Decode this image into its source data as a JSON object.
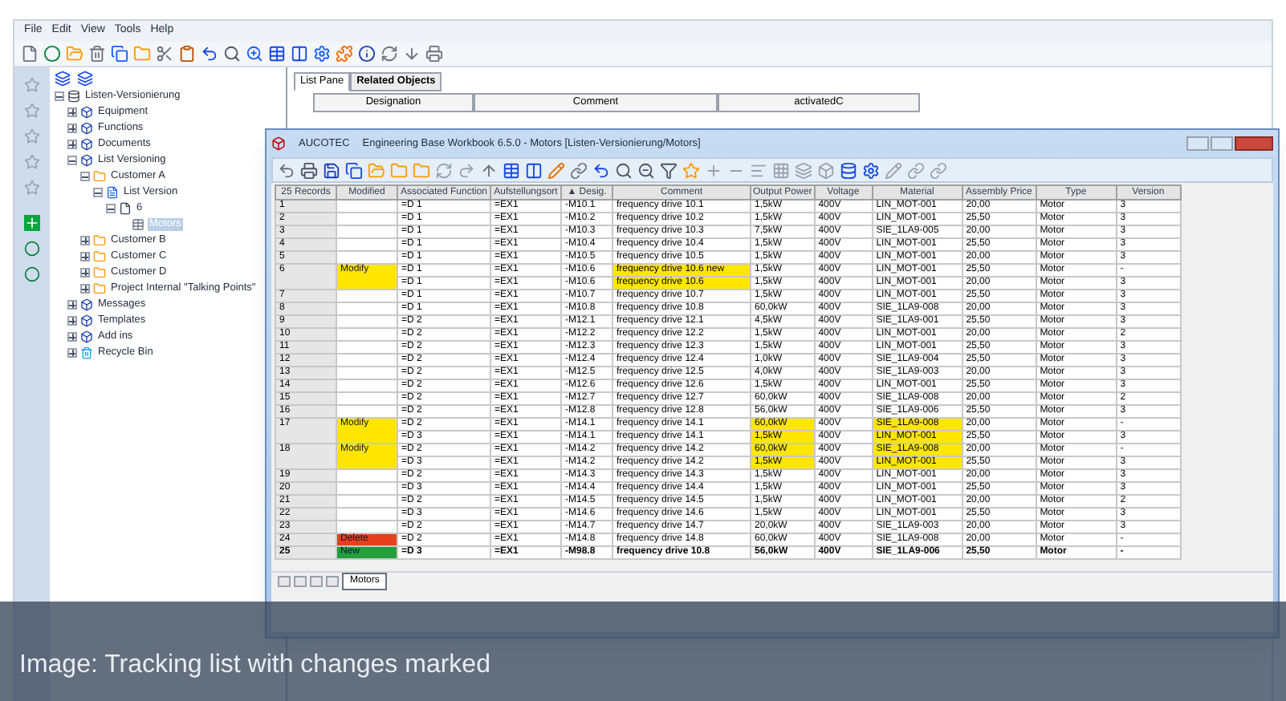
{
  "app": {
    "menu": [
      "File",
      "Edit",
      "View",
      "Tools",
      "Help"
    ],
    "tree": [
      {
        "label": "Listen-Versionierung",
        "kind": "root",
        "expanded": true,
        "children": [
          {
            "label": "Equipment",
            "kind": "module",
            "expanded": false
          },
          {
            "label": "Functions",
            "kind": "module",
            "expanded": false
          },
          {
            "label": "Documents",
            "kind": "module",
            "expanded": false
          },
          {
            "label": "List Versioning",
            "kind": "module",
            "expanded": true,
            "children": [
              {
                "label": "Customer A",
                "kind": "folder",
                "expanded": true,
                "children": [
                  {
                    "label": "List Version",
                    "kind": "version",
                    "expanded": true,
                    "children": [
                      {
                        "label": "6",
                        "kind": "sheet",
                        "expanded": true,
                        "children": [
                          {
                            "label": "Motors",
                            "kind": "item",
                            "selected": true
                          }
                        ]
                      }
                    ]
                  }
                ]
              },
              {
                "label": "Customer B",
                "kind": "folder",
                "expanded": false
              },
              {
                "label": "Customer C",
                "kind": "folder",
                "expanded": false
              },
              {
                "label": "Customer D",
                "kind": "folder",
                "expanded": false
              },
              {
                "label": "Project Internal \"Talking Points\"",
                "kind": "folder",
                "expanded": false
              }
            ]
          },
          {
            "label": "Messages",
            "kind": "module",
            "expanded": false
          },
          {
            "label": "Templates",
            "kind": "module",
            "expanded": false
          },
          {
            "label": "Add ins",
            "kind": "module",
            "expanded": false
          },
          {
            "label": "Recycle Bin",
            "kind": "bin",
            "expanded": false
          }
        ]
      }
    ],
    "pane_tabs": [
      {
        "label": "List Pane",
        "selected": true
      },
      {
        "label": "Related Objects",
        "selected": false
      }
    ],
    "pane_columns": [
      "Designation",
      "Comment",
      "activatedC"
    ]
  },
  "workbook": {
    "brand": "AUCOTEC",
    "title": "Engineering Base Workbook 6.5.0 - Motors [Listen-Versionierung/Motors]",
    "columns": [
      "25 Records",
      "Modified",
      "Associated Function",
      "Aufstellungsort",
      "▲ Desig.",
      "Comment",
      "Output Power",
      "Voltage",
      "Material",
      "Assembly Price",
      "Type",
      "Version"
    ],
    "rows": [
      {
        "number": "1",
        "lines": [
          {
            "func": "=D 1",
            "location": "=EX1",
            "desig": "-M10.1",
            "comment": "frequency drive 10.1",
            "power": "1,5kW",
            "voltage": "400V",
            "material": "LIN_MOT-001",
            "price": "20,00",
            "type": "Motor",
            "version": "3"
          }
        ]
      },
      {
        "number": "2",
        "lines": [
          {
            "func": "=D 1",
            "location": "=EX1",
            "desig": "-M10.2",
            "comment": "frequency drive 10.2",
            "power": "1,5kW",
            "voltage": "400V",
            "material": "LIN_MOT-001",
            "price": "25,50",
            "type": "Motor",
            "version": "3"
          }
        ]
      },
      {
        "number": "3",
        "lines": [
          {
            "func": "=D 1",
            "location": "=EX1",
            "desig": "-M10.3",
            "comment": "frequency drive 10.3",
            "power": "7,5kW",
            "voltage": "400V",
            "material": "SIE_1LA9-005",
            "price": "20,00",
            "type": "Motor",
            "version": "3"
          }
        ]
      },
      {
        "number": "4",
        "lines": [
          {
            "func": "=D 1",
            "location": "=EX1",
            "desig": "-M10.4",
            "comment": "frequency drive 10.4",
            "power": "1,5kW",
            "voltage": "400V",
            "material": "LIN_MOT-001",
            "price": "25,50",
            "type": "Motor",
            "version": "3"
          }
        ]
      },
      {
        "number": "5",
        "lines": [
          {
            "func": "=D 1",
            "location": "=EX1",
            "desig": "-M10.5",
            "comment": "frequency drive 10.5",
            "power": "1,5kW",
            "voltage": "400V",
            "material": "LIN_MOT-001",
            "price": "20,00",
            "type": "Motor",
            "version": "3"
          }
        ]
      },
      {
        "number": "6",
        "status": {
          "text": "Modify",
          "color": "#ffe600"
        },
        "lines": [
          {
            "func": "=D 1",
            "location": "=EX1",
            "desig": "-M10.6",
            "comment": "frequency drive 10.6 new",
            "power": "1,5kW",
            "voltage": "400V",
            "material": "LIN_MOT-001",
            "price": "25,50",
            "type": "Motor",
            "version": "-",
            "comment_changed": true,
            "power_changed": false,
            "material_changed": false
          },
          {
            "func": "=D 1",
            "location": "=EX1",
            "desig": "-M10.6",
            "comment": "frequency drive 10.6",
            "power": "1,5kW",
            "voltage": "400V",
            "material": "LIN_MOT-001",
            "price": "20,00",
            "type": "Motor",
            "version": "3",
            "comment_changed": true,
            "power_changed": false,
            "material_changed": false
          }
        ]
      },
      {
        "number": "7",
        "lines": [
          {
            "func": "=D 1",
            "location": "=EX1",
            "desig": "-M10.7",
            "comment": "frequency drive 10.7",
            "power": "1,5kW",
            "voltage": "400V",
            "material": "LIN_MOT-001",
            "price": "25,50",
            "type": "Motor",
            "version": "3"
          }
        ]
      },
      {
        "number": "8",
        "lines": [
          {
            "func": "=D 1",
            "location": "=EX1",
            "desig": "-M10.8",
            "comment": "frequency drive 10.8",
            "power": "60,0kW",
            "voltage": "400V",
            "material": "SIE_1LA9-008",
            "price": "20,00",
            "type": "Motor",
            "version": "3"
          }
        ]
      },
      {
        "number": "9",
        "lines": [
          {
            "func": "=D 2",
            "location": "=EX1",
            "desig": "-M12.1",
            "comment": "frequency drive 12.1",
            "power": "4,5kW",
            "voltage": "400V",
            "material": "SIE_1LA9-001",
            "price": "25,50",
            "type": "Motor",
            "version": "3"
          }
        ]
      },
      {
        "number": "10",
        "lines": [
          {
            "func": "=D 2",
            "location": "=EX1",
            "desig": "-M12.2",
            "comment": "frequency drive 12.2",
            "power": "1,5kW",
            "voltage": "400V",
            "material": "LIN_MOT-001",
            "price": "20,00",
            "type": "Motor",
            "version": "2"
          }
        ]
      },
      {
        "number": "11",
        "lines": [
          {
            "func": "=D 2",
            "location": "=EX1",
            "desig": "-M12.3",
            "comment": "frequency drive 12.3",
            "power": "1,5kW",
            "voltage": "400V",
            "material": "LIN_MOT-001",
            "price": "25,50",
            "type": "Motor",
            "version": "3"
          }
        ]
      },
      {
        "number": "12",
        "lines": [
          {
            "func": "=D 2",
            "location": "=EX1",
            "desig": "-M12.4",
            "comment": "frequency drive 12.4",
            "power": "1,0kW",
            "voltage": "400V",
            "material": "SIE_1LA9-004",
            "price": "25,50",
            "type": "Motor",
            "version": "3"
          }
        ]
      },
      {
        "number": "13",
        "lines": [
          {
            "func": "=D 2",
            "location": "=EX1",
            "desig": "-M12.5",
            "comment": "frequency drive 12.5",
            "power": "4,0kW",
            "voltage": "400V",
            "material": "SIE_1LA9-003",
            "price": "20,00",
            "type": "Motor",
            "version": "3"
          }
        ]
      },
      {
        "number": "14",
        "lines": [
          {
            "func": "=D 2",
            "location": "=EX1",
            "desig": "-M12.6",
            "comment": "frequency drive 12.6",
            "power": "1,5kW",
            "voltage": "400V",
            "material": "LIN_MOT-001",
            "price": "25,50",
            "type": "Motor",
            "version": "3"
          }
        ]
      },
      {
        "number": "15",
        "lines": [
          {
            "func": "=D 2",
            "location": "=EX1",
            "desig": "-M12.7",
            "comment": "frequency drive 12.7",
            "power": "60,0kW",
            "voltage": "400V",
            "material": "SIE_1LA9-008",
            "price": "20,00",
            "type": "Motor",
            "version": "2"
          }
        ]
      },
      {
        "number": "16",
        "lines": [
          {
            "func": "=D 2",
            "location": "=EX1",
            "desig": "-M12.8",
            "comment": "frequency drive 12.8",
            "power": "56,0kW",
            "voltage": "400V",
            "material": "SIE_1LA9-006",
            "price": "25,50",
            "type": "Motor",
            "version": "3"
          }
        ]
      },
      {
        "number": "17",
        "status": {
          "text": "Modify",
          "color": "#ffe600"
        },
        "lines": [
          {
            "func": "=D 2",
            "location": "=EX1",
            "desig": "-M14.1",
            "comment": "frequency drive 14.1",
            "power": "60,0kW",
            "voltage": "400V",
            "material": "SIE_1LA9-008",
            "price": "20,00",
            "type": "Motor",
            "version": "-",
            "comment_changed": false,
            "power_changed": true,
            "material_changed": true
          },
          {
            "func": "=D 3",
            "location": "=EX1",
            "desig": "-M14.1",
            "comment": "frequency drive 14.1",
            "power": "1,5kW",
            "voltage": "400V",
            "material": "LIN_MOT-001",
            "price": "25,50",
            "type": "Motor",
            "version": "3",
            "comment_changed": false,
            "power_changed": true,
            "material_changed": true
          }
        ]
      },
      {
        "number": "18",
        "status": {
          "text": "Modify",
          "color": "#ffe600"
        },
        "lines": [
          {
            "func": "=D 2",
            "location": "=EX1",
            "desig": "-M14.2",
            "comment": "frequency drive 14.2",
            "power": "60,0kW",
            "voltage": "400V",
            "material": "SIE_1LA9-008",
            "price": "20,00",
            "type": "Motor",
            "version": "-",
            "comment_changed": false,
            "power_changed": true,
            "material_changed": true
          },
          {
            "func": "=D 3",
            "location": "=EX1",
            "desig": "-M14.2",
            "comment": "frequency drive 14.2",
            "power": "1,5kW",
            "voltage": "400V",
            "material": "LIN_MOT-001",
            "price": "25,50",
            "type": "Motor",
            "version": "3",
            "comment_changed": false,
            "power_changed": true,
            "material_changed": true
          }
        ]
      },
      {
        "number": "19",
        "lines": [
          {
            "func": "=D 2",
            "location": "=EX1",
            "desig": "-M14.3",
            "comment": "frequency drive 14.3",
            "power": "1,5kW",
            "voltage": "400V",
            "material": "LIN_MOT-001",
            "price": "20,00",
            "type": "Motor",
            "version": "3"
          }
        ]
      },
      {
        "number": "20",
        "lines": [
          {
            "func": "=D 3",
            "location": "=EX1",
            "desig": "-M14.4",
            "comment": "frequency drive 14.4",
            "power": "1,5kW",
            "voltage": "400V",
            "material": "LIN_MOT-001",
            "price": "25,50",
            "type": "Motor",
            "version": "3"
          }
        ]
      },
      {
        "number": "21",
        "lines": [
          {
            "func": "=D 2",
            "location": "=EX1",
            "desig": "-M14.5",
            "comment": "frequency drive 14.5",
            "power": "1,5kW",
            "voltage": "400V",
            "material": "LIN_MOT-001",
            "price": "20,00",
            "type": "Motor",
            "version": "2"
          }
        ]
      },
      {
        "number": "22",
        "lines": [
          {
            "func": "=D 3",
            "location": "=EX1",
            "desig": "-M14.6",
            "comment": "frequency drive 14.6",
            "power": "1,5kW",
            "voltage": "400V",
            "material": "LIN_MOT-001",
            "price": "25,50",
            "type": "Motor",
            "version": "3"
          }
        ]
      },
      {
        "number": "23",
        "lines": [
          {
            "func": "=D 2",
            "location": "=EX1",
            "desig": "-M14.7",
            "comment": "frequency drive 14.7",
            "power": "20,0kW",
            "voltage": "400V",
            "material": "SIE_1LA9-003",
            "price": "20,00",
            "type": "Motor",
            "version": "3"
          }
        ]
      },
      {
        "number": "24",
        "status": {
          "text": "Delete",
          "color": "#e8401c"
        },
        "lines": [
          {
            "func": "=D 2",
            "location": "=EX1",
            "desig": "-M14.8",
            "comment": "frequency drive 14.8",
            "power": "60,0kW",
            "voltage": "400V",
            "material": "SIE_1LA9-008",
            "price": "20,00",
            "type": "Motor",
            "version": "-"
          }
        ]
      },
      {
        "number": "25",
        "status": {
          "text": "New",
          "color": "#22a03c"
        },
        "bold": true,
        "lines": [
          {
            "func": "=D 3",
            "location": "=EX1",
            "desig": "-M98.8",
            "comment": "frequency drive 10.8",
            "power": "56,0kW",
            "voltage": "400V",
            "material": "SIE_1LA9-006",
            "price": "25,50",
            "type": "Motor",
            "version": "-"
          }
        ]
      }
    ],
    "sheet_tabs": [
      {
        "label": "Motors",
        "selected": true
      }
    ]
  },
  "caption": "Image: Tracking list with changes marked"
}
